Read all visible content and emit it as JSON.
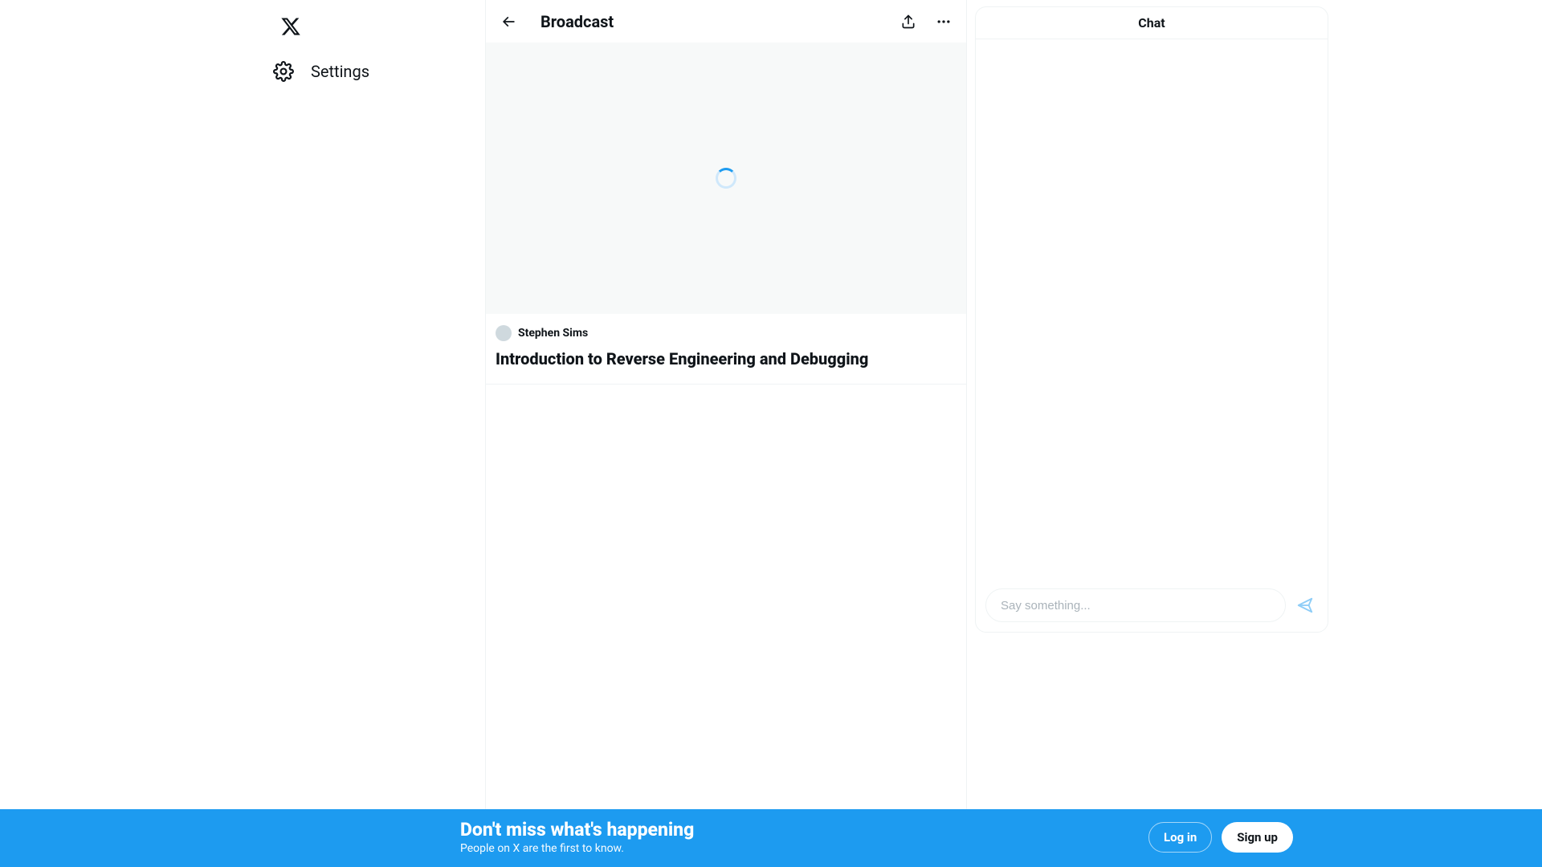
{
  "sidebar": {
    "items": [
      {
        "label": "Settings",
        "icon": "gear-icon"
      }
    ]
  },
  "header": {
    "title": "Broadcast"
  },
  "broadcast": {
    "author": "Stephen Sims",
    "title": "Introduction to Reverse Engineering and Debugging"
  },
  "chat": {
    "header": "Chat",
    "placeholder": "Say something..."
  },
  "banner": {
    "title": "Don't miss what's happening",
    "subtitle": "People on X are the first to know.",
    "login": "Log in",
    "signup": "Sign up"
  },
  "colors": {
    "accent": "#1d9bf0",
    "border": "#eff3f4",
    "text": "#0f1419",
    "muted": "#536471"
  }
}
